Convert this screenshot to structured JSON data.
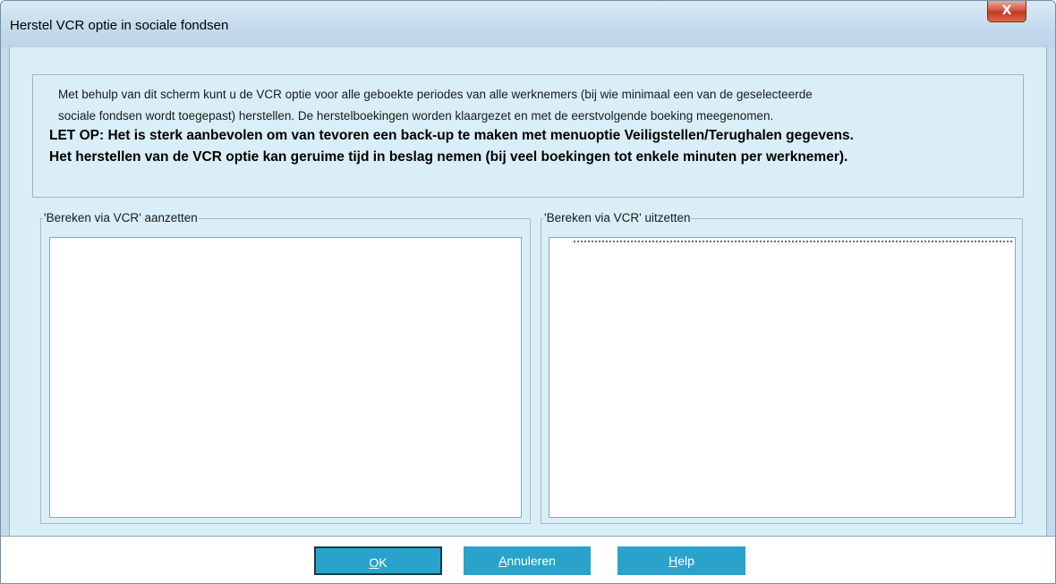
{
  "window": {
    "title": "Herstel VCR optie in sociale fondsen",
    "close_glyph": "X"
  },
  "info": {
    "line1": "Met behulp van dit scherm kunt u de VCR optie voor alle geboekte periodes van alle werknemers (bij wie minimaal een van de geselecteerde",
    "line2": "sociale fondsen wordt toegepast) herstellen. De herstelboekingen worden klaargezet en met de eerstvolgende boeking meegenomen.",
    "warning1": "LET OP: Het is sterk aanbevolen om van tevoren een back-up te maken met menuoptie Veiligstellen/Terughalen gegevens.",
    "warning2": "Het herstellen van de VCR optie kan geruime tijd in beslag nemen (bij veel boekingen tot enkele minuten per werknemer)."
  },
  "groups": {
    "left_label": "'Bereken via VCR' aanzetten",
    "right_label": "'Bereken via VCR' uitzetten"
  },
  "buttons": {
    "ok": {
      "accel": "O",
      "rest": "K"
    },
    "annuleren": {
      "accel": "A",
      "rest": "nnuleren"
    },
    "help": {
      "accel": "H",
      "rest": "elp"
    }
  },
  "icons": {
    "close": "close-icon"
  }
}
